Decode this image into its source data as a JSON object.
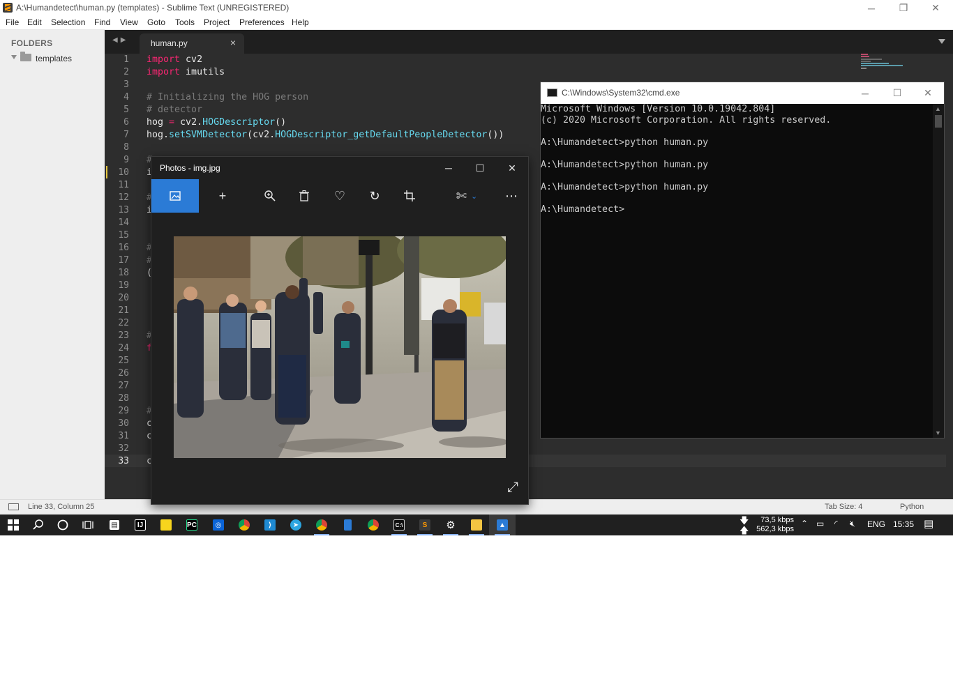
{
  "sublime": {
    "title": "A:\\Humandetect\\human.py (templates) - Sublime Text (UNREGISTERED)",
    "menu": [
      "File",
      "Edit",
      "Selection",
      "Find",
      "View",
      "Goto",
      "Tools",
      "Project",
      "Preferences",
      "Help"
    ],
    "sidebar": {
      "header": "FOLDERS",
      "folder": "templates"
    },
    "tab": {
      "label": "human.py",
      "close": "×"
    },
    "line_numbers": [
      "1",
      "2",
      "3",
      "4",
      "5",
      "6",
      "7",
      "8",
      "9",
      "10",
      "11",
      "12",
      "13",
      "14",
      "15",
      "16",
      "17",
      "18",
      "19",
      "20",
      "21",
      "22",
      "23",
      "24",
      "25",
      "26",
      "27",
      "28",
      "29",
      "30",
      "31",
      "32",
      "33"
    ],
    "active_line": "33",
    "code": {
      "l1_kw": "import",
      "l1_rest": " cv2",
      "l2_kw": "import",
      "l2_rest": " imutils",
      "l4": "# Initializing the HOG person",
      "l5": "# detector",
      "l6_a": "hog ",
      "l6_op": "=",
      "l6_b": " cv2.",
      "l6_fn": "HOGDescriptor",
      "l6_c": "()",
      "l7_a": "hog.",
      "l7_fn": "setSVMDetector",
      "l7_b": "(cv2.",
      "l7_fn2": "HOGDescriptor_getDefaultPeopleDetector",
      "l7_c": "())",
      "l9": "#",
      "l10": "i",
      "l12": "#",
      "l13": "i",
      "l16": "#",
      "l17": "#",
      "l18": "(",
      "l23": "#",
      "l24": "f",
      "l29": "#",
      "l30": "c",
      "l31": "c",
      "l33": "c"
    },
    "status": {
      "position": "Line 33, Column 25",
      "tab_size": "Tab Size: 4",
      "syntax": "Python"
    }
  },
  "cmd": {
    "title": "C:\\Windows\\System32\\cmd.exe",
    "lines": [
      "Microsoft Windows [Version 10.0.19042.804]",
      "(c) 2020 Microsoft Corporation. All rights reserved.",
      "",
      "A:\\Humandetect>python human.py",
      "",
      "A:\\Humandetect>python human.py",
      "",
      "A:\\Humandetect>python human.py",
      "",
      "A:\\Humandetect>"
    ]
  },
  "photos": {
    "title": "Photos - img.jpg",
    "toolbar": [
      "image-icon",
      "add-icon",
      "zoom-icon",
      "delete-icon",
      "heart-icon",
      "rotate-icon",
      "crop-icon",
      "edit-icon",
      "more-icon"
    ]
  },
  "taskbar": {
    "download": "73,5 kbps",
    "upload": "562,3 kbps",
    "lang": "ENG",
    "time": "15:35"
  },
  "colors": {
    "editor_bg": "#2d2d2d",
    "keyword": "#f92672",
    "function": "#66d9ef",
    "comment": "#7a7a7a",
    "photos_accent": "#2b7bd6"
  }
}
